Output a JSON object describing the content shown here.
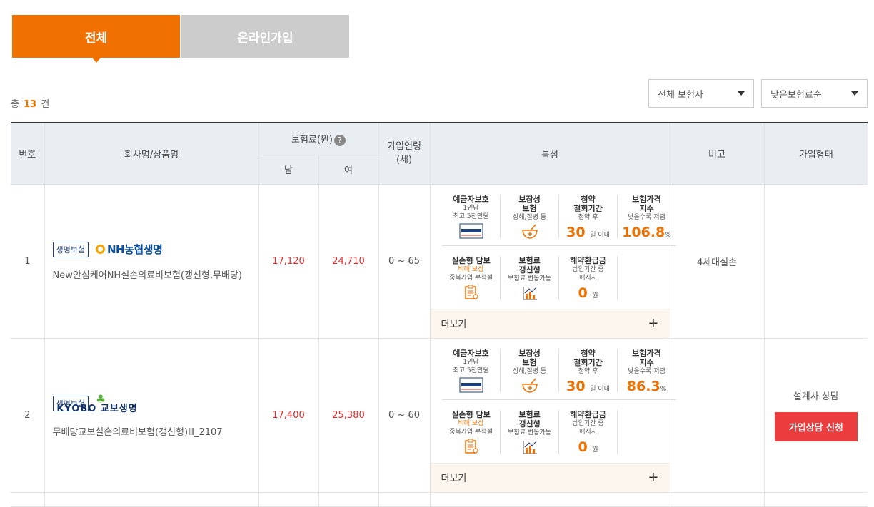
{
  "tabs": [
    {
      "label": "전체",
      "active": true
    },
    {
      "label": "온라인가입",
      "active": false
    }
  ],
  "count": {
    "prefix": "총",
    "value": "13",
    "suffix": "건"
  },
  "filters": {
    "company": "전체 보험사",
    "sort": "낮은보험료순"
  },
  "table": {
    "headers": {
      "no": "번호",
      "company": "회사명/상품명",
      "premium": "보험료(원)",
      "male": "남",
      "female": "여",
      "age": "가입연령\n(세)",
      "features": "특성",
      "note": "비고",
      "type": "가입형태"
    },
    "rows": [
      {
        "no": "1",
        "badge": "생명보험",
        "logo": "NH농협생명",
        "product": "New안심케어NH실손의료비보험(갱신형,무배당)",
        "male": "17,120",
        "female": "24,710",
        "age": "0 ~ 65",
        "features": {
          "f1": {
            "t": "예금자보호",
            "s1": "1인당",
            "s2": "최고 5천만원",
            "icon": "deposit-protection-seal-icon"
          },
          "f2": {
            "t": "보장성\n보험",
            "s": "상해,질병 등",
            "icon": "medicine-bowl-icon"
          },
          "f3": {
            "t": "청약\n철회기간",
            "s": "청약 후",
            "v": "30",
            "u": "일 이내"
          },
          "f4": {
            "t": "보험가격\n지수",
            "s": "낮을수록 저렴",
            "v": "106.8",
            "u": "%"
          },
          "f5": {
            "t": "실손형 담보",
            "o": "비례 보상",
            "s": "중복가입 부적절",
            "icon": "clipboard-icon"
          },
          "f6": {
            "t": "보험료\n갱신형",
            "s": "보험료 변동가능",
            "icon": "chart-icon"
          },
          "f7": {
            "t": "해약환급금",
            "s1": "납입기간 중",
            "s2": "해지시",
            "v": "0",
            "u": "원"
          }
        },
        "more": "더보기",
        "note": "4세대실손",
        "join": ""
      },
      {
        "no": "2",
        "badge": "생명보험",
        "logo": "KYOBO 교보생명",
        "product": "무배당교보실손의료비보험(갱신형)Ⅲ_2107",
        "male": "17,400",
        "female": "25,380",
        "age": "0 ~ 60",
        "features": {
          "f1": {
            "t": "예금자보호",
            "s1": "1인당",
            "s2": "최고 5천만원",
            "icon": "deposit-protection-seal-icon"
          },
          "f2": {
            "t": "보장성\n보험",
            "s": "상해,질병 등",
            "icon": "medicine-bowl-icon"
          },
          "f3": {
            "t": "청약\n철회기간",
            "s": "청약 후",
            "v": "30",
            "u": "일 이내"
          },
          "f4": {
            "t": "보험가격\n지수",
            "s": "낮을수록 저렴",
            "v": "86.3",
            "u": "%"
          },
          "f5": {
            "t": "실손형 담보",
            "o": "비례 보상",
            "s": "중복가입 부적절",
            "icon": "clipboard-icon"
          },
          "f6": {
            "t": "보험료\n갱신형",
            "s": "보험료 변동가능",
            "icon": "chart-icon"
          },
          "f7": {
            "t": "해약환급금",
            "s1": "납입기간 중",
            "s2": "해지시",
            "v": "0",
            "u": "원"
          }
        },
        "more": "더보기",
        "note": "",
        "join": "설계사 상담",
        "join_button": "가입상담 신청"
      }
    ]
  },
  "colors": {
    "accent": "#f07100",
    "price": "#e32b2b",
    "button": "#eb3d3d"
  }
}
